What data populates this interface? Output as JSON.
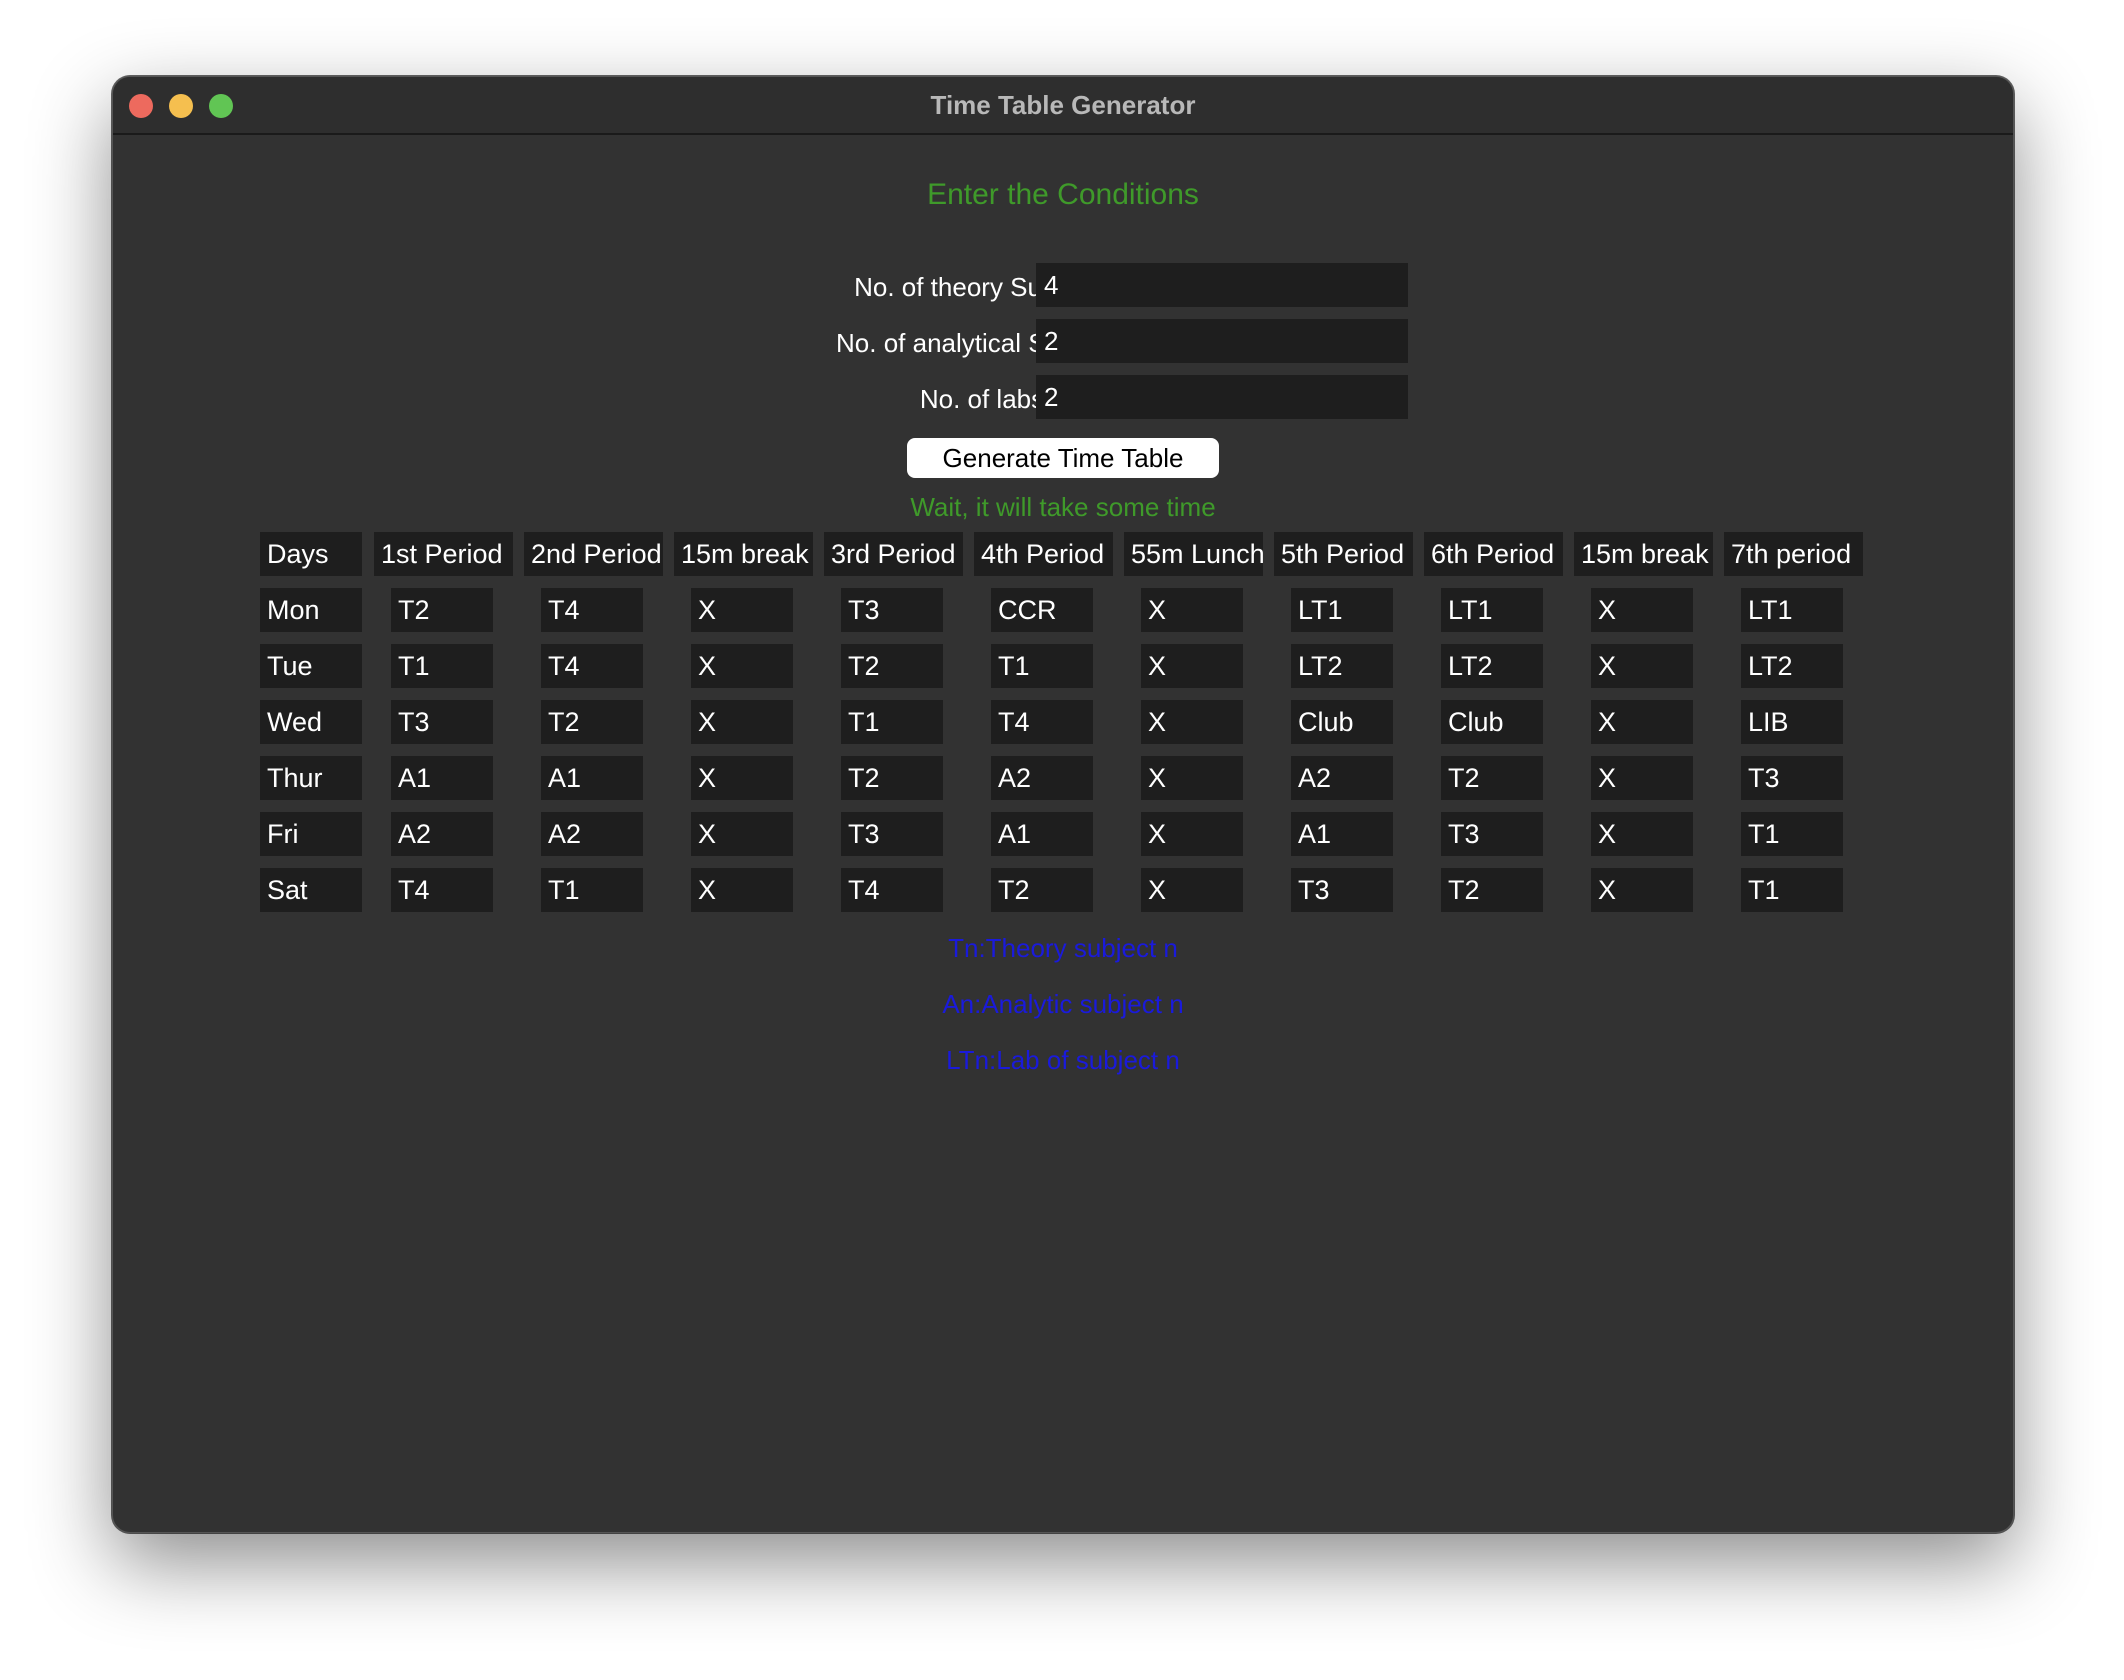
{
  "window": {
    "title": "Time Table Generator"
  },
  "form": {
    "heading": "Enter the Conditions",
    "fields": [
      {
        "label": "No. of theory Subjects",
        "value": "4"
      },
      {
        "label": "No. of analytical Subjects",
        "value": "2"
      },
      {
        "label": "No. of labs",
        "value": "2"
      }
    ],
    "button_label": "Generate Time Table",
    "status": "Wait, it will take some time"
  },
  "timetable": {
    "headers": [
      "Days",
      "1st Period",
      "2nd Period",
      "15m break",
      "3rd Period",
      "4th Period",
      "55m Lunch",
      "5th Period",
      "6th Period",
      "15m break",
      "7th period"
    ],
    "rows": [
      [
        "Mon",
        "T2",
        "T4",
        "X",
        "T3",
        "CCR",
        "X",
        "LT1",
        "LT1",
        "X",
        "LT1"
      ],
      [
        "Tue",
        "T1",
        "T4",
        "X",
        "T2",
        "T1",
        "X",
        "LT2",
        "LT2",
        "X",
        "LT2"
      ],
      [
        "Wed",
        "T3",
        "T2",
        "X",
        "T1",
        "T4",
        "X",
        "Club",
        "Club",
        "X",
        "LIB"
      ],
      [
        "Thur",
        "A1",
        "A1",
        "X",
        "T2",
        "A2",
        "X",
        "A2",
        "T2",
        "X",
        "T3"
      ],
      [
        "Fri",
        "A2",
        "A2",
        "X",
        "T3",
        "A1",
        "X",
        "A1",
        "T3",
        "X",
        "T1"
      ],
      [
        "Sat",
        "T4",
        "T1",
        "X",
        "T4",
        "T2",
        "X",
        "T3",
        "T2",
        "X",
        "T1"
      ]
    ]
  },
  "legend": [
    "Tn:Theory subject n",
    "An:Analytic subject n",
    "LTn:Lab of subject n"
  ],
  "colors": {
    "window_bg": "#323232",
    "cell_bg": "#1e1e1e",
    "heading_green": "#3f9a2a",
    "legend_blue": "#1a1adb"
  }
}
